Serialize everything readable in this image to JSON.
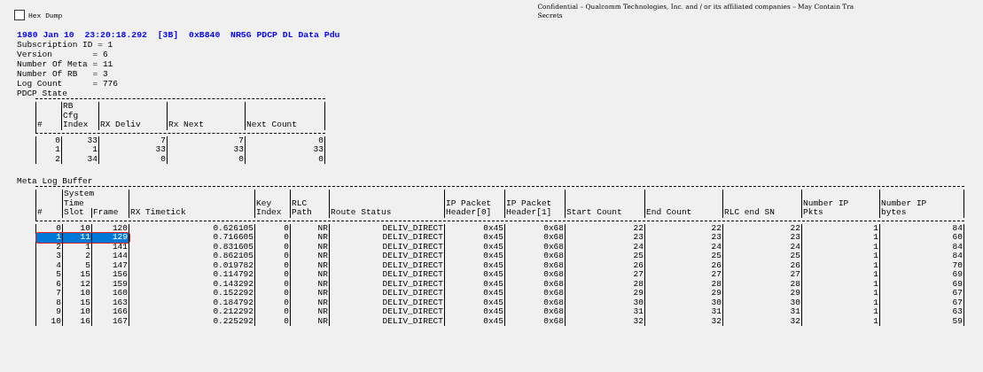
{
  "hex_dump": {
    "label": "Hex Dump",
    "checked": false
  },
  "notice": [
    "Confidential – Qualcomm Technologies, Inc. and / or its affiliated companies – May Contain Tra",
    "Secrets"
  ],
  "log_header": "1980 Jan 10  23:20:18.292  [3B]  0xB840  NR5G PDCP DL Data Pdu",
  "fields": [
    "Subscription ID = 1",
    "Version        = 6",
    "Number Of Meta = 11",
    "Number Of RB   = 3",
    "Log Count      = 776"
  ],
  "pdcp_state": {
    "title": "PDCP State",
    "columns": [
      "#",
      "RB\nCfg\nIndex",
      "RX Deliv",
      "Rx Next",
      "Next Count"
    ],
    "rows": [
      [
        "0",
        "33",
        "7",
        "7",
        "0"
      ],
      [
        "1",
        "1",
        "33",
        "33",
        "33"
      ],
      [
        "2",
        "34",
        "0",
        "0",
        "0"
      ]
    ]
  },
  "meta_log_buffer": {
    "title": "Meta Log Buffer",
    "group_header": "System\nTime",
    "columns": [
      "#",
      "Slot",
      "Frame",
      "RX Timetick",
      "Key\nIndex",
      "RLC\nPath",
      "Route Status",
      "IP Packet\nHeader[0]",
      "IP Packet\nHeader[1]",
      "Start Count",
      "End Count",
      "RLC end SN",
      "Number IP\nPkts",
      "Number IP\nbytes"
    ],
    "rows": [
      {
        "selected": false,
        "cells": [
          "0",
          "10",
          "120",
          "0.626105",
          "0",
          "NR",
          "DELIV_DIRECT",
          "0x45",
          "0x68",
          "22",
          "22",
          "22",
          "1",
          "84"
        ]
      },
      {
        "selected": true,
        "cells": [
          "1",
          "11",
          "129",
          "0.716605",
          "0",
          "NR",
          "DELIV_DIRECT",
          "0x45",
          "0x68",
          "23",
          "23",
          "23",
          "1",
          "60"
        ]
      },
      {
        "selected": false,
        "cells": [
          "2",
          "1",
          "141",
          "0.831605",
          "0",
          "NR",
          "DELIV_DIRECT",
          "0x45",
          "0x68",
          "24",
          "24",
          "24",
          "1",
          "84"
        ]
      },
      {
        "selected": false,
        "cells": [
          "3",
          "2",
          "144",
          "0.862105",
          "0",
          "NR",
          "DELIV_DIRECT",
          "0x45",
          "0x68",
          "25",
          "25",
          "25",
          "1",
          "84"
        ]
      },
      {
        "selected": false,
        "cells": [
          "4",
          "5",
          "147",
          "0.019782",
          "0",
          "NR",
          "DELIV_DIRECT",
          "0x45",
          "0x68",
          "26",
          "26",
          "26",
          "1",
          "70"
        ]
      },
      {
        "selected": false,
        "cells": [
          "5",
          "15",
          "156",
          "0.114792",
          "0",
          "NR",
          "DELIV_DIRECT",
          "0x45",
          "0x68",
          "27",
          "27",
          "27",
          "1",
          "69"
        ]
      },
      {
        "selected": false,
        "cells": [
          "6",
          "12",
          "159",
          "0.143292",
          "0",
          "NR",
          "DELIV_DIRECT",
          "0x45",
          "0x68",
          "28",
          "28",
          "28",
          "1",
          "69"
        ]
      },
      {
        "selected": false,
        "cells": [
          "7",
          "10",
          "160",
          "0.152292",
          "0",
          "NR",
          "DELIV_DIRECT",
          "0x45",
          "0x68",
          "29",
          "29",
          "29",
          "1",
          "67"
        ]
      },
      {
        "selected": false,
        "cells": [
          "8",
          "15",
          "163",
          "0.184792",
          "0",
          "NR",
          "DELIV_DIRECT",
          "0x45",
          "0x68",
          "30",
          "30",
          "30",
          "1",
          "67"
        ]
      },
      {
        "selected": false,
        "cells": [
          "9",
          "10",
          "166",
          "0.212292",
          "0",
          "NR",
          "DELIV_DIRECT",
          "0x45",
          "0x68",
          "31",
          "31",
          "31",
          "1",
          "63"
        ]
      },
      {
        "selected": false,
        "cells": [
          "10",
          "16",
          "167",
          "0.225292",
          "0",
          "NR",
          "DELIV_DIRECT",
          "0x45",
          "0x68",
          "32",
          "32",
          "32",
          "1",
          "59"
        ]
      }
    ]
  }
}
